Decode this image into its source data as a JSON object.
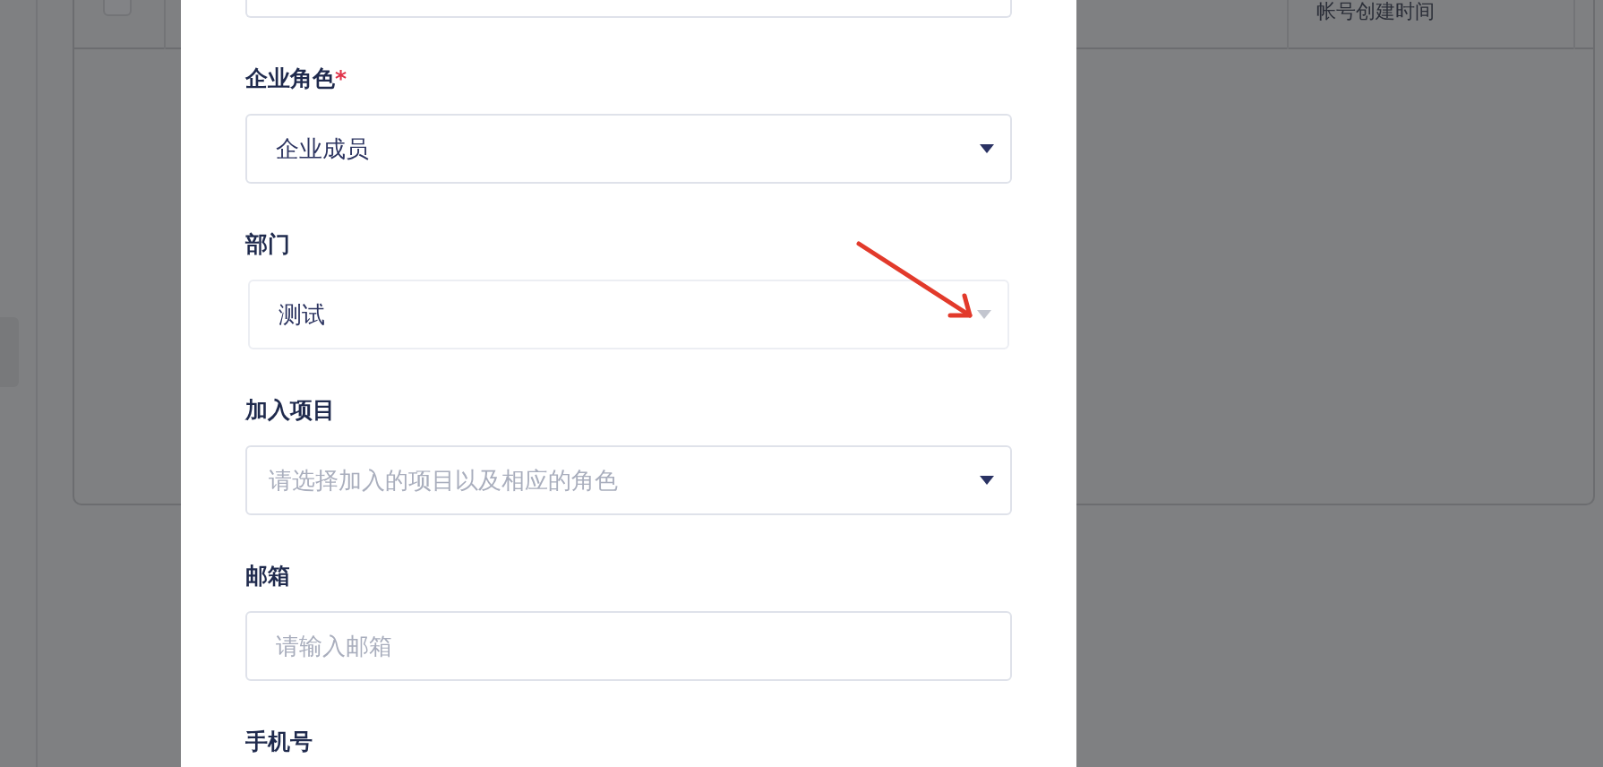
{
  "background": {
    "table": {
      "select_all": {
        "checked": false
      },
      "columns": [
        {
          "label": "帐号创建时间"
        }
      ]
    }
  },
  "dialog": {
    "fields": [
      {
        "kind": "select",
        "label": "企业角色",
        "required_mark": "*",
        "value": "企业成员",
        "disabled": false
      },
      {
        "kind": "select",
        "label": "部门",
        "value": "测试",
        "disabled": true
      },
      {
        "kind": "select",
        "label": "加入项目",
        "placeholder": "请选择加入的项目以及相应的角色",
        "disabled": false
      },
      {
        "kind": "input",
        "label": "邮箱",
        "placeholder": "请输入邮箱"
      },
      {
        "kind": "label_only",
        "label": "手机号"
      }
    ]
  }
}
